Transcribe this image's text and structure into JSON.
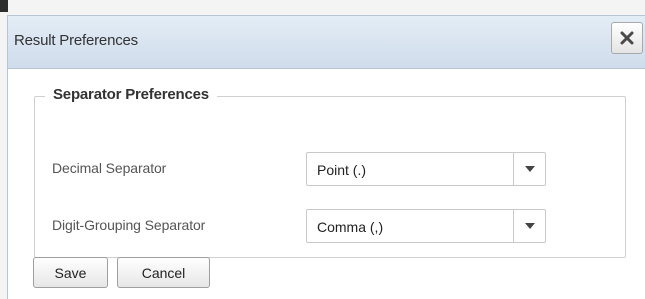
{
  "dialog": {
    "title": "Result Preferences",
    "close_icon": "close-icon"
  },
  "separator_section": {
    "legend": "Separator Preferences",
    "rows": [
      {
        "label": "Decimal Separator",
        "value": "Point (.)"
      },
      {
        "label": "Digit-Grouping Separator",
        "value": "Comma (,)"
      }
    ],
    "dropdown_icon": "caret-down-icon"
  },
  "footer": {
    "save_label": "Save",
    "cancel_label": "Cancel"
  },
  "colors": {
    "title_bar_top": "#e3edf6",
    "title_bar_bottom": "#cfdceb",
    "border": "#b7c4d1"
  }
}
